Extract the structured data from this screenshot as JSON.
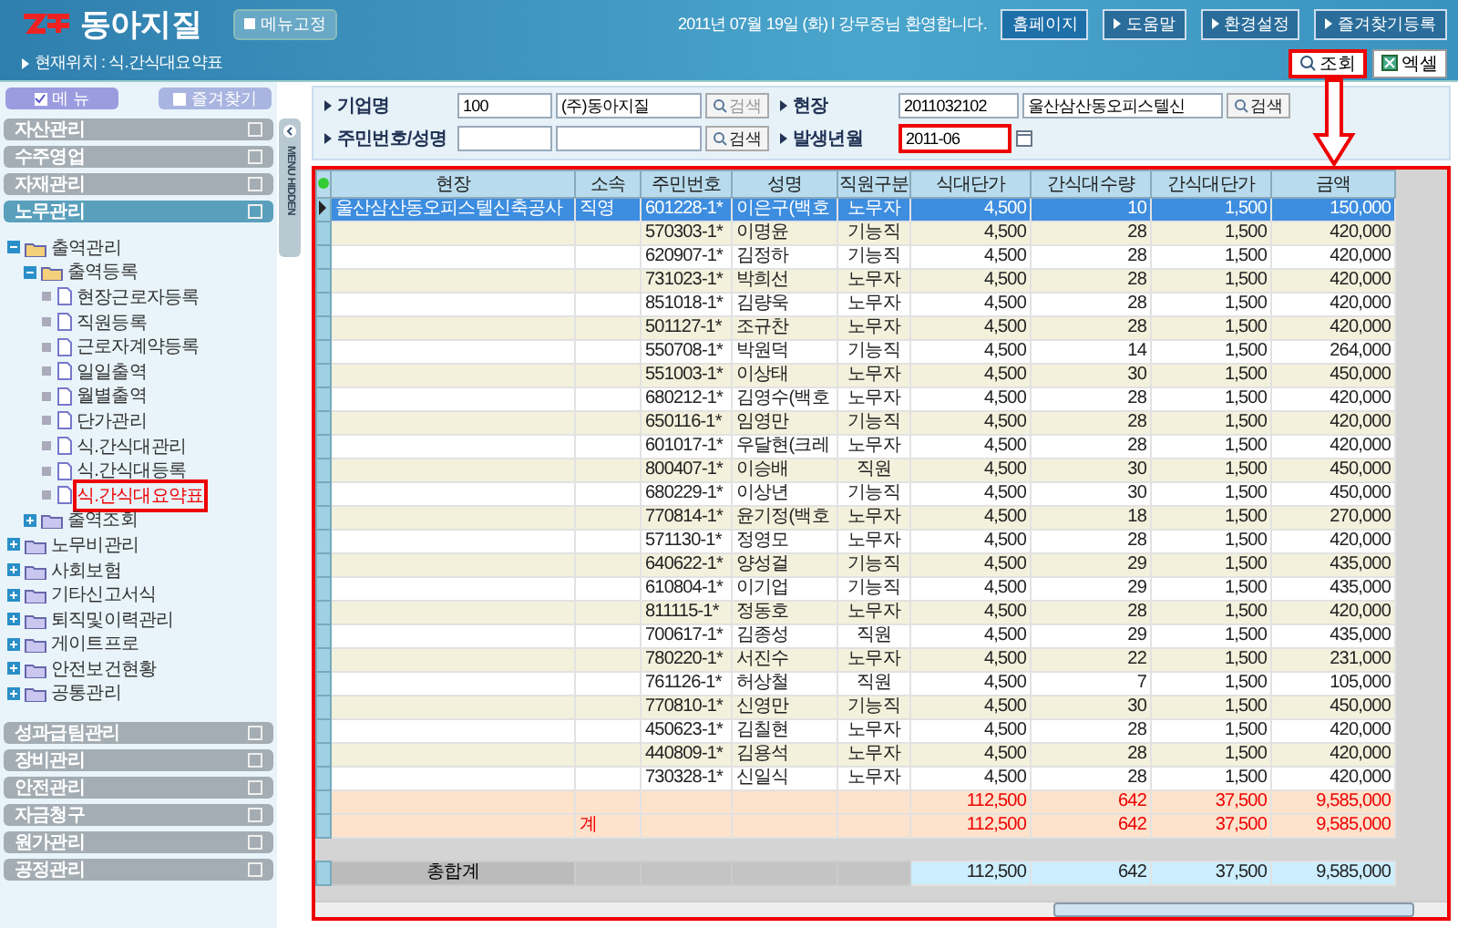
{
  "header": {
    "logo": "동아지질",
    "pin_button": "메뉴고정",
    "greeting": "2011년 07월 19일 (화) l 강무중님 환영합니다.",
    "nav_buttons": [
      {
        "label": "홈페이지",
        "kind": "home"
      },
      {
        "label": "도움말",
        "kind": "link"
      },
      {
        "label": "환경설정",
        "kind": "link"
      },
      {
        "label": "즐겨찾기등록",
        "kind": "link"
      }
    ],
    "breadcrumb": "현재위치 : 식.간식대요약표",
    "actions": [
      {
        "label": "조회",
        "kind": "search",
        "annotated": true
      },
      {
        "label": "엑셀",
        "kind": "excel",
        "annotated": false
      }
    ]
  },
  "sidebar": {
    "toggles": [
      {
        "label": "메   뉴",
        "checked": true
      },
      {
        "label": "즐겨찾기",
        "checked": false
      }
    ],
    "sections_top": [
      {
        "label": "자산관리",
        "selected": false
      },
      {
        "label": "수주영업",
        "selected": false
      },
      {
        "label": "자재관리",
        "selected": false
      },
      {
        "label": "노무관리",
        "selected": true
      }
    ],
    "tree": [
      {
        "label": "출역관리",
        "kind": "folder",
        "expanded": true,
        "children": [
          {
            "label": "출역등록",
            "kind": "folder",
            "expanded": true,
            "children": [
              {
                "label": "현장근로자등록",
                "kind": "page",
                "selected": false
              },
              {
                "label": "직원등록",
                "kind": "page",
                "selected": false
              },
              {
                "label": "근로자계약등록",
                "kind": "page",
                "selected": false
              },
              {
                "label": "일일출역",
                "kind": "page",
                "selected": false
              },
              {
                "label": "월별출역",
                "kind": "page",
                "selected": false
              },
              {
                "label": "단가관리",
                "kind": "page",
                "selected": false
              },
              {
                "label": "식.간식대관리",
                "kind": "page",
                "selected": false
              },
              {
                "label": "식.간식대등록",
                "kind": "page",
                "selected": false
              },
              {
                "label": "식.간식대요약표",
                "kind": "page",
                "selected": true
              }
            ]
          },
          {
            "label": "출역조회",
            "kind": "folder",
            "expanded": false
          }
        ]
      },
      {
        "label": "노무비관리",
        "kind": "folder",
        "expanded": false
      },
      {
        "label": "사회보험",
        "kind": "folder",
        "expanded": false
      },
      {
        "label": "기타신고서식",
        "kind": "folder",
        "expanded": false
      },
      {
        "label": "퇴직및이력관리",
        "kind": "folder",
        "expanded": false
      },
      {
        "label": "게이트프로",
        "kind": "folder",
        "expanded": false
      },
      {
        "label": "안전보건현황",
        "kind": "folder",
        "expanded": false
      },
      {
        "label": "공통관리",
        "kind": "folder",
        "expanded": false
      }
    ],
    "sections_bottom": [
      {
        "label": "성과급팀관리",
        "selected": false
      },
      {
        "label": "장비관리",
        "selected": false
      },
      {
        "label": "안전관리",
        "selected": false
      },
      {
        "label": "자금청구",
        "selected": false
      },
      {
        "label": "원가관리",
        "selected": false
      },
      {
        "label": "공정관리",
        "selected": false
      }
    ]
  },
  "menu_hidden": "MENU HIDDEN",
  "filters": [
    {
      "label": "기업명",
      "code": "100",
      "name": "(주)동아지질",
      "button": "검색",
      "disabled": true
    },
    {
      "label": "현장",
      "code": "2011032102",
      "name": "울산삼산동오피스텔신",
      "button": "검색",
      "disabled": false
    },
    {
      "label": "주민번호/성명",
      "button": "검색",
      "disabled": false
    },
    {
      "label": "발생년월",
      "code": "2011-06",
      "kind": "date",
      "annotated": true
    }
  ],
  "table": {
    "annotated": true,
    "columns": [
      "현장",
      "소속",
      "주민번호",
      "성명",
      "직원구분",
      "식대단가",
      "간식대수량",
      "간식대단가",
      "금액"
    ],
    "rows": [
      {
        "selected": true,
        "site": "울산삼산동오피스텔신축공사",
        "dept": "직영",
        "id": "601228-1*",
        "name": "이은구(백호",
        "type": "노무자",
        "meal": "4,500",
        "qty": "10",
        "snack": "1,500",
        "amount": "150,000"
      },
      {
        "selected": false,
        "id": "570303-1*",
        "name": "이명윤",
        "type": "기능직",
        "meal": "4,500",
        "qty": "28",
        "snack": "1,500",
        "amount": "420,000"
      },
      {
        "selected": false,
        "id": "620907-1*",
        "name": "김정하",
        "type": "기능직",
        "meal": "4,500",
        "qty": "28",
        "snack": "1,500",
        "amount": "420,000"
      },
      {
        "selected": false,
        "id": "731023-1*",
        "name": "박희선",
        "type": "노무자",
        "meal": "4,500",
        "qty": "28",
        "snack": "1,500",
        "amount": "420,000"
      },
      {
        "selected": false,
        "id": "851018-1*",
        "name": "김량욱",
        "type": "노무자",
        "meal": "4,500",
        "qty": "28",
        "snack": "1,500",
        "amount": "420,000"
      },
      {
        "selected": false,
        "id": "501127-1*",
        "name": "조규찬",
        "type": "노무자",
        "meal": "4,500",
        "qty": "28",
        "snack": "1,500",
        "amount": "420,000"
      },
      {
        "selected": false,
        "id": "550708-1*",
        "name": "박원덕",
        "type": "기능직",
        "meal": "4,500",
        "qty": "14",
        "snack": "1,500",
        "amount": "264,000"
      },
      {
        "selected": false,
        "id": "551003-1*",
        "name": "이상태",
        "type": "노무자",
        "meal": "4,500",
        "qty": "30",
        "snack": "1,500",
        "amount": "450,000"
      },
      {
        "selected": false,
        "id": "680212-1*",
        "name": "김영수(백호",
        "type": "노무자",
        "meal": "4,500",
        "qty": "28",
        "snack": "1,500",
        "amount": "420,000"
      },
      {
        "selected": false,
        "id": "650116-1*",
        "name": "임영만",
        "type": "기능직",
        "meal": "4,500",
        "qty": "28",
        "snack": "1,500",
        "amount": "420,000"
      },
      {
        "selected": false,
        "id": "601017-1*",
        "name": "우달현(크레",
        "type": "노무자",
        "meal": "4,500",
        "qty": "28",
        "snack": "1,500",
        "amount": "420,000"
      },
      {
        "selected": false,
        "id": "800407-1*",
        "name": "이승배",
        "type": "직원",
        "meal": "4,500",
        "qty": "30",
        "snack": "1,500",
        "amount": "450,000"
      },
      {
        "selected": false,
        "id": "680229-1*",
        "name": "이상년",
        "type": "기능직",
        "meal": "4,500",
        "qty": "30",
        "snack": "1,500",
        "amount": "450,000"
      },
      {
        "selected": false,
        "id": "770814-1*",
        "name": "윤기정(백호",
        "type": "노무자",
        "meal": "4,500",
        "qty": "18",
        "snack": "1,500",
        "amount": "270,000"
      },
      {
        "selected": false,
        "id": "571130-1*",
        "name": "정영모",
        "type": "노무자",
        "meal": "4,500",
        "qty": "28",
        "snack": "1,500",
        "amount": "420,000"
      },
      {
        "selected": false,
        "id": "640622-1*",
        "name": "양성걸",
        "type": "기능직",
        "meal": "4,500",
        "qty": "29",
        "snack": "1,500",
        "amount": "435,000"
      },
      {
        "selected": false,
        "id": "610804-1*",
        "name": "이기업",
        "type": "기능직",
        "meal": "4,500",
        "qty": "29",
        "snack": "1,500",
        "amount": "435,000"
      },
      {
        "selected": false,
        "id": "811115-1*",
        "name": "정동호",
        "type": "노무자",
        "meal": "4,500",
        "qty": "28",
        "snack": "1,500",
        "amount": "420,000"
      },
      {
        "selected": false,
        "id": "700617-1*",
        "name": "김종성",
        "type": "직원",
        "meal": "4,500",
        "qty": "29",
        "snack": "1,500",
        "amount": "435,000"
      },
      {
        "selected": false,
        "id": "780220-1*",
        "name": "서진수",
        "type": "노무자",
        "meal": "4,500",
        "qty": "22",
        "snack": "1,500",
        "amount": "231,000"
      },
      {
        "selected": false,
        "id": "761126-1*",
        "name": "허상철",
        "type": "직원",
        "meal": "4,500",
        "qty": "7",
        "snack": "1,500",
        "amount": "105,000"
      },
      {
        "selected": false,
        "id": "770810-1*",
        "name": "신영만",
        "type": "기능직",
        "meal": "4,500",
        "qty": "30",
        "snack": "1,500",
        "amount": "450,000"
      },
      {
        "selected": false,
        "id": "450623-1*",
        "name": "김칠현",
        "type": "노무자",
        "meal": "4,500",
        "qty": "28",
        "snack": "1,500",
        "amount": "420,000"
      },
      {
        "selected": false,
        "id": "440809-1*",
        "name": "김용석",
        "type": "노무자",
        "meal": "4,500",
        "qty": "28",
        "snack": "1,500",
        "amount": "420,000"
      },
      {
        "selected": false,
        "id": "730328-1*",
        "name": "신일식",
        "type": "노무자",
        "meal": "4,500",
        "qty": "28",
        "snack": "1,500",
        "amount": "420,000"
      }
    ],
    "subtotals": [
      {
        "meal": "112,500",
        "qty": "642",
        "snack": "37,500",
        "amount": "9,585,000"
      },
      {
        "dept": "계",
        "meal": "112,500",
        "qty": "642",
        "snack": "37,500",
        "amount": "9,585,000"
      }
    ],
    "total": {
      "label": "총합계",
      "meal": "112,500",
      "qty": "642",
      "snack": "37,500",
      "amount": "9,585,000"
    }
  }
}
